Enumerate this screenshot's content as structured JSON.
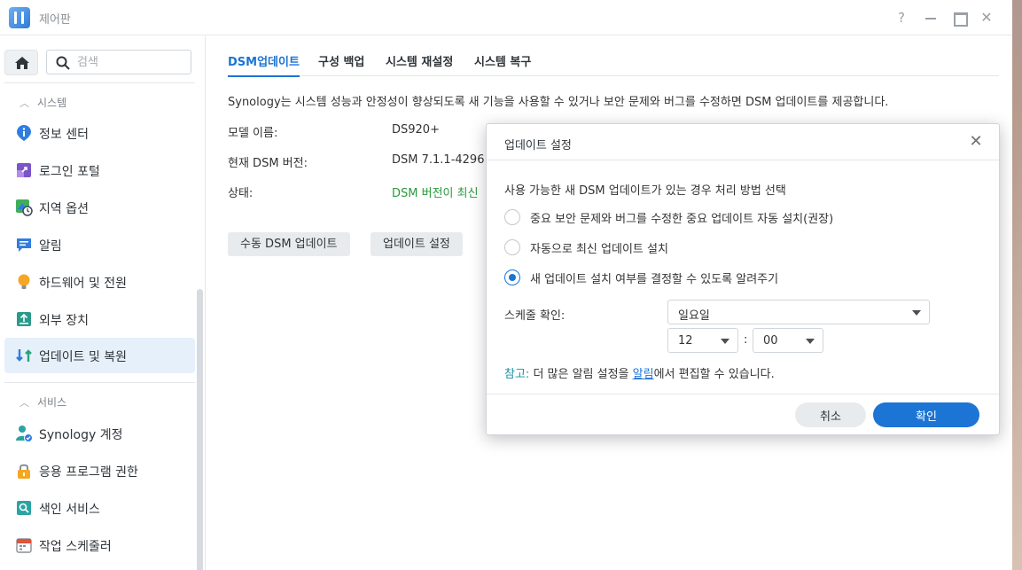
{
  "window": {
    "title": "제어판",
    "help_glyph": "?",
    "close_glyph": "✕"
  },
  "sidebar": {
    "search_placeholder": "검색",
    "section_system": "시스템",
    "section_services": "서비스",
    "items": [
      {
        "label": "정보 센터",
        "icon": "info-icon"
      },
      {
        "label": "로그인 포털",
        "icon": "login-portal-icon"
      },
      {
        "label": "지역 옵션",
        "icon": "regional-options-icon"
      },
      {
        "label": "알림",
        "icon": "notification-icon"
      },
      {
        "label": "하드웨어 및 전원",
        "icon": "hardware-power-icon"
      },
      {
        "label": "외부 장치",
        "icon": "external-device-icon"
      },
      {
        "label": "업데이트 및 복원",
        "icon": "update-restore-icon",
        "active": true
      }
    ],
    "service_items": [
      {
        "label": "Synology 계정",
        "icon": "synology-account-icon"
      },
      {
        "label": "응용 프로그램 권한",
        "icon": "app-privileges-icon"
      },
      {
        "label": "색인 서비스",
        "icon": "indexing-service-icon"
      },
      {
        "label": "작업 스케줄러",
        "icon": "task-scheduler-icon"
      }
    ]
  },
  "main": {
    "tabs": [
      "DSM업데이트",
      "구성 백업",
      "시스템 재설정",
      "시스템 복구"
    ],
    "description": "Synology는 시스템 성능과 안정성이 향상되도록 새 기능을 사용할 수 있거나 보안 문제와 버그를 수정하면 DSM 업데이트를 제공합니다.",
    "model_label": "모델 이름:",
    "model_value": "DS920+",
    "version_label": "현재 DSM 버전:",
    "version_value": "DSM 7.1.1-4296",
    "status_label": "상태:",
    "status_value": "DSM 버전이 최신",
    "manual_update_button": "수동 DSM 업데이트",
    "update_settings_button": "업데이트 설정"
  },
  "dialog": {
    "title": "업데이트 설정",
    "close_glyph": "✕",
    "prompt": "사용 가능한 새 DSM 업데이트가 있는 경우 처리 방법 선택",
    "options": [
      {
        "label": "중요 보안 문제와 버그를 수정한 중요 업데이트 자동 설치(권장)",
        "checked": false
      },
      {
        "label": "자동으로 최신 업데이트 설치",
        "checked": false
      },
      {
        "label": "새 업데이트 설치 여부를 결정할 수 있도록 알려주기",
        "checked": true
      }
    ],
    "schedule_label": "스케줄 확인:",
    "day_value": "일요일",
    "hour_value": "12",
    "time_separator": ":",
    "minute_value": "00",
    "note_prefix": "참고:",
    "note_text_1": " 더 많은 알림 설정을 ",
    "note_link": "알림",
    "note_text_2": "에서 편집할 수 있습니다.",
    "cancel_button": "취소",
    "ok_button": "확인"
  }
}
